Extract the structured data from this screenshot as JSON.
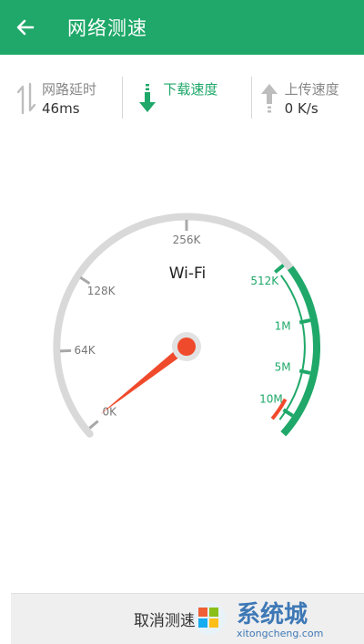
{
  "header": {
    "title": "网络测速",
    "back_icon": "arrow-left-icon"
  },
  "stats": {
    "latency": {
      "label": "网路延时",
      "value": "46ms",
      "icon": "up-down-arrows-icon"
    },
    "download": {
      "label": "下载速度",
      "value": "",
      "icon": "download-arrow-icon"
    },
    "upload": {
      "label": "上传速度",
      "value": "0 K/s",
      "icon": "upload-arrow-icon"
    }
  },
  "gauge": {
    "network_label": "Wi-Fi",
    "ticks": [
      "0K",
      "64K",
      "128K",
      "256K",
      "512K",
      "1M",
      "5M",
      "10M"
    ],
    "needle_position": "0K"
  },
  "footer": {
    "cancel_label": "取消测速"
  },
  "colors": {
    "primary_green": "#1fa869",
    "needle_red": "#f04a2c",
    "gauge_gray": "#d9d9d9"
  }
}
